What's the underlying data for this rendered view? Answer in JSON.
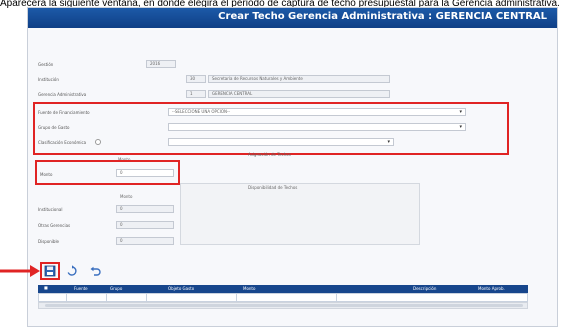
{
  "caption": "Aparecerá la siguiente ventana, en donde elegirá el periodo de captura de techo presupuestal para la Gerencia administrativa.",
  "window": {
    "title": "Crear Techo Gerencia Administrativa : GERENCIA CENTRAL"
  },
  "form": {
    "gestion_label": "Gestión",
    "gestion_value": "2016",
    "institucion_label": "Institución",
    "institucion_code": "30",
    "institucion_value": "Secretaría de Recursos Naturales y Ambiente",
    "gerencia_label": "Gerencia Administrativa",
    "gerencia_code": "1",
    "gerencia_value": "GERENCIA CENTRAL",
    "fuente_label": "Fuente de Financiamiento",
    "fuente_placeholder": "--SELECCIONE UNA OPCION--",
    "grupo_label": "Grupo de Gasto",
    "clasificacion_label": "Clasificación Económica",
    "asignacion_section": "Asignación de Techos",
    "monto_col": "Monto",
    "monto_label": "Monto",
    "monto_value": "0",
    "disponibilidad_section": "Disponibilidad de Techos",
    "disp_col": "Monto",
    "institucional_label": "Institucional",
    "otras_label": "Otras Gerencias",
    "disponible_label": "Disponible",
    "institucional_value": "0",
    "otras_value": "0",
    "disponible_value": "0"
  },
  "toolbar": {
    "save_icon": "save-icon",
    "refresh_icon": "refresh-icon",
    "undo_icon": "undo-icon"
  },
  "grid": {
    "headers": [
      "Fuente",
      "Grupo",
      "Objeto Gasto",
      "Monto",
      "Descripción",
      "Monto Aprob."
    ]
  },
  "colors": {
    "title_bar": "#1c5aa8",
    "highlight": "#e02424",
    "grid_header": "#17468c"
  }
}
